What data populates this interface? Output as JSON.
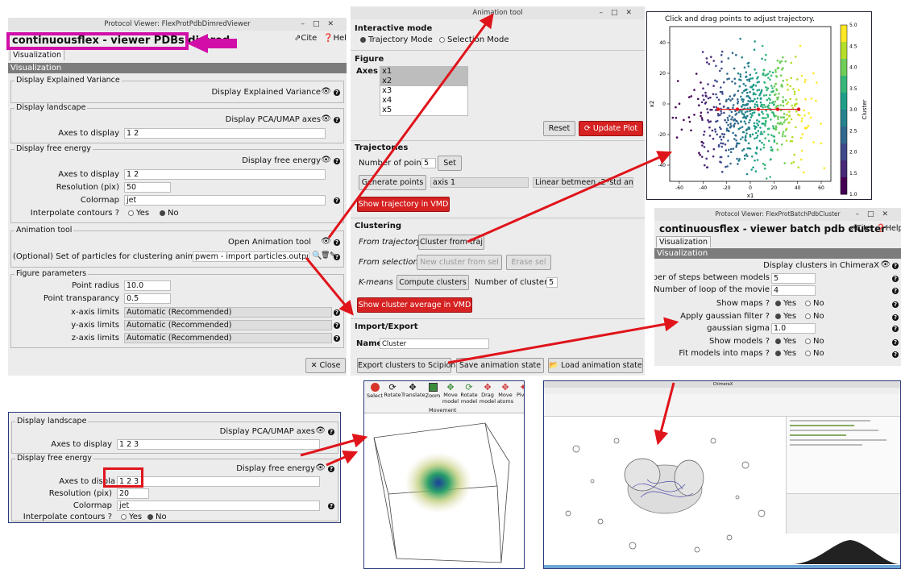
{
  "pdbdimred": {
    "window_title": "Protocol Viewer: FlexProtPdbDimredViewer",
    "header_title": "continuousflex - viewer PDBs dimred",
    "cite": "Cite",
    "help": "Help",
    "tab": "Visualization",
    "bar": "Visualization",
    "g_var": "Display Explained Variance",
    "var_btn": "Display Explained Variance",
    "g_land": "Display landscape",
    "land_btn": "Display PCA/UMAP axes",
    "axes_lbl": "Axes to display",
    "axes_val": "1 2",
    "g_free": "Display free energy",
    "free_btn": "Display free energy",
    "axes2_val": "1 2",
    "res_lbl": "Resolution (pix)",
    "res_val": "50",
    "cmap_lbl": "Colormap",
    "cmap_val": "jet",
    "interp_lbl": "Interpolate contours ?",
    "yes": "Yes",
    "no": "No",
    "g_anim": "Animation tool",
    "anim_btn": "Open Animation tool",
    "particles_lbl": "(Optional) Set of particles for clustering animation",
    "particles_val": "pwem - import particles.outputP",
    "g_fig": "Figure parameters",
    "radius_lbl": "Point radius",
    "radius_val": "10.0",
    "transp_lbl": "Point transparancy",
    "transp_val": "0.5",
    "xlim_lbl": "x-axis limits",
    "ylim_lbl": "y-axis limits",
    "zlim_lbl": "z-axis limits",
    "lim_val": "Automatic (Recommended)",
    "close": "Close"
  },
  "anim": {
    "window_title": "Animation tool",
    "interactive": "Interactive mode",
    "traj_mode": "Trajectory Mode",
    "sel_mode": "Selection Mode",
    "figure": "Figure",
    "axes": "Axes",
    "axes_list": [
      "x1",
      "x2",
      "x3",
      "x4",
      "x5"
    ],
    "reset": "Reset",
    "update": "Update Plot",
    "trajectories": "Trajectories",
    "npoints_lbl": "Number of points",
    "npoints_val": "5",
    "set": "Set",
    "generate": "Generate points",
    "axis_val": "axis 1",
    "linear_val": "Linear betmeen -2*std an",
    "vmd_traj": "Show trajectory in VMD",
    "clustering": "Clustering",
    "from_traj": "From trajectory",
    "cluster_traj": "Cluster from traj",
    "from_sel": "From selection",
    "new_cluster": "New cluster from sel",
    "erase_sel": "Erase sel",
    "kmeans": "K-means",
    "compute": "Compute clusters",
    "nclust_lbl": "Number of clusters",
    "nclust_val": "5",
    "vmd_cluster": "Show cluster average in VMD",
    "import_export": "Import/Export",
    "name_lbl": "Name",
    "name_val": "Cluster",
    "export": "Export clusters to Scipion",
    "save": "Save animation state",
    "load": "Load animation state"
  },
  "scatter": {
    "title": "Click and drag points to adjust trajectory.",
    "xlabel": "x1",
    "ylabel": "x2",
    "cbar_label": "Cluster",
    "xticks": [
      "-60",
      "-40",
      "-20",
      "0",
      "20",
      "40",
      "60"
    ],
    "yticks": [
      "40",
      "20",
      "0",
      "-20",
      "-40"
    ],
    "cticks": [
      "5.0",
      "4.5",
      "4.0",
      "3.5",
      "3.0",
      "2.5",
      "2.0",
      "1.5",
      "1.0"
    ]
  },
  "batch": {
    "window_title": "Protocol Viewer: FlexProtBatchPdbCluster",
    "header_title": "continuousflex - viewer batch pdb cluster",
    "cite": "Cite",
    "help": "Help",
    "tab": "Visualization",
    "bar": "Visualization",
    "display_btn": "Display clusters in ChimeraX",
    "steps_lbl": "Number of steps between models",
    "steps_val": "5",
    "loop_lbl": "Number of loop of the movie",
    "loop_val": "4",
    "maps_lbl": "Show maps ?",
    "gauss_lbl": "Apply gaussian filter ?",
    "sigma_lbl": "gaussian sigma",
    "sigma_val": "1.0",
    "models_lbl": "Show models ?",
    "fit_lbl": "Fit models into maps ?",
    "yes": "Yes",
    "no": "No"
  },
  "land3d": {
    "g_land": "Display landscape",
    "land_btn": "Display PCA/UMAP axes",
    "axes_lbl": "Axes to display",
    "axes_val": "1 2 3",
    "g_free": "Display free energy",
    "free_btn": "Display free energy",
    "axes2_lbl": "Axes to displa",
    "axes2_val": "1 2 3",
    "res_lbl": "Resolution (pix)",
    "res_val": "20",
    "cmap_lbl": "Colormap",
    "cmap_val": "jet",
    "interp_lbl": "Interpolate contours ?",
    "yes": "Yes",
    "no": "No"
  },
  "vmd": {
    "tools": [
      "Select",
      "Rotate",
      "Translate",
      "Zoom",
      "Move model",
      "Rotate model",
      "Drag model",
      "Move atoms",
      "Pivot"
    ],
    "group": "Movement"
  },
  "chimerax": {
    "window_title": "ChimeraX"
  },
  "colors": {
    "magenta": "#d10fa8",
    "red_arrow": "#e0141b",
    "red_button": "#d62222"
  }
}
